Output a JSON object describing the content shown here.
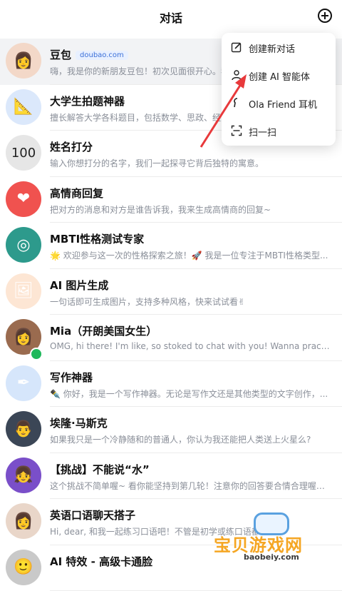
{
  "header": {
    "title": "对话",
    "add_icon": "plus-circle-icon"
  },
  "conversations": [
    {
      "title": "豆包",
      "badge": "doubao.com",
      "subtitle": "嗨，我是你的新朋友豆包！初次见面很开心。我可以...",
      "avatar_color": "#f3d8c8",
      "avatar_glyph": "👩",
      "active": true
    },
    {
      "title": "大学生拍题神器",
      "subtitle": "擅长解答大学各科题目，包括数学、思政、经济学等",
      "avatar_color": "#dbe8fb",
      "avatar_glyph": "📐"
    },
    {
      "title": "姓名打分",
      "subtitle": "输入你想打分的名字，我们一起探寻它背后独特的寓意。",
      "avatar_color": "#e6e6e6",
      "avatar_glyph": "100"
    },
    {
      "title": "高情商回复",
      "subtitle": "把对方的消息和对方是谁告诉我，我来生成高情商的回复~",
      "avatar_color": "#f0524f",
      "avatar_glyph": "❤"
    },
    {
      "title": "MBTI性格测试专家",
      "subtitle": "🌟 欢迎参与这一次的性格探索之旅！🚀 我是一位专注于MBTI性格类型...",
      "avatar_color": "#2d9a8c",
      "avatar_glyph": "◎"
    },
    {
      "title": "AI 图片生成",
      "subtitle": "一句话即可生成图片，支持多种风格，快来试试看✌",
      "avatar_color": "#fde6d4",
      "avatar_glyph": "🖼"
    },
    {
      "title": "Mia（开朗美国女生）",
      "subtitle": "OMG, hi there! I'm like, so stoked to chat with you! Wanna practice some...",
      "avatar_color": "#9a6b4f",
      "avatar_glyph": "👩",
      "online": true
    },
    {
      "title": "写作神器",
      "subtitle": "✒️ 你好，我是一个写作神器。无论是写作文还是其他类型的文字创作，...",
      "avatar_color": "#d6e6fb",
      "avatar_glyph": "✒"
    },
    {
      "title": "埃隆·马斯克",
      "subtitle": "如果我只是一个冷静随和的普通人，你认为我还能把人类送上火星么?",
      "avatar_color": "#3b4656",
      "avatar_glyph": "👨"
    },
    {
      "title": "【挑战】不能说“水”",
      "subtitle": "这个挑战不简单喔~ 看你能坚持到第几轮！注意你的回答要合情合理喔~ ...",
      "avatar_color": "#7a4fc9",
      "avatar_glyph": "👧"
    },
    {
      "title": "英语口语聊天搭子",
      "subtitle": "Hi, dear, 和我一起练习口语吧！不管是初学或练口语都可以...",
      "avatar_color": "#e9d6c9",
      "avatar_glyph": "👩"
    },
    {
      "title": "AI 特效 - 高级卡通脸",
      "subtitle": "",
      "avatar_color": "#c9c9c9",
      "avatar_glyph": "🙂"
    }
  ],
  "menu": {
    "items": [
      {
        "label": "创建新对话",
        "icon": "edit-icon"
      },
      {
        "label": "创建 AI 智能体",
        "icon": "person-icon"
      },
      {
        "label": "Ola Friend 耳机",
        "icon": "earphone-icon"
      },
      {
        "label": "扫一扫",
        "icon": "scan-icon"
      }
    ]
  },
  "annotation": {
    "color": "#e8393b"
  },
  "watermark": {
    "text": "宝贝游戏网",
    "url": "baobeiy.com"
  }
}
